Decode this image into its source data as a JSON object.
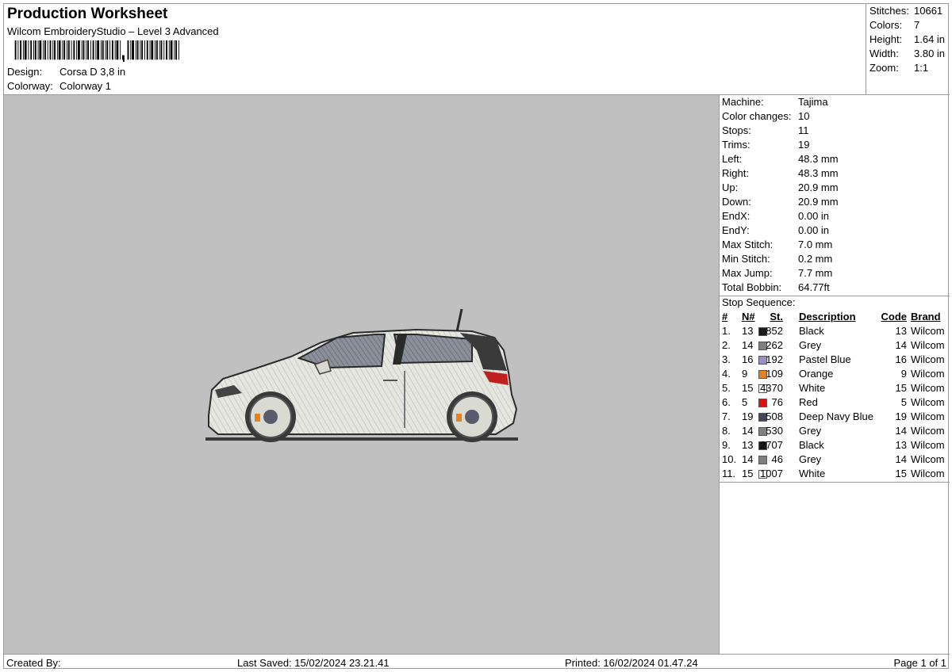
{
  "header": {
    "title": "Production Worksheet",
    "subtitle": "Wilcom EmbroideryStudio – Level 3 Advanced",
    "design_label": "Design:",
    "design_value": "Corsa D 3,8 in",
    "colorway_label": "Colorway:",
    "colorway_value": "Colorway 1"
  },
  "summary": [
    {
      "label": "Stitches:",
      "value": "10661"
    },
    {
      "label": "Colors:",
      "value": "7"
    },
    {
      "label": "Height:",
      "value": "1.64 in"
    },
    {
      "label": "Width:",
      "value": "3.80 in"
    },
    {
      "label": "Zoom:",
      "value": "1:1"
    }
  ],
  "machine_info": [
    {
      "label": "Machine:",
      "value": "Tajima"
    },
    {
      "label": "Color changes:",
      "value": "10"
    },
    {
      "label": "Stops:",
      "value": "11"
    },
    {
      "label": "Trims:",
      "value": "19"
    },
    {
      "label": "Left:",
      "value": "48.3 mm"
    },
    {
      "label": "Right:",
      "value": "48.3 mm"
    },
    {
      "label": "Up:",
      "value": "20.9 mm"
    },
    {
      "label": "Down:",
      "value": "20.9 mm"
    },
    {
      "label": "EndX:",
      "value": "0.00 in"
    },
    {
      "label": "EndY:",
      "value": "0.00 in"
    },
    {
      "label": "Max Stitch:",
      "value": "7.0 mm"
    },
    {
      "label": "Min Stitch:",
      "value": "0.2 mm"
    },
    {
      "label": "Max Jump:",
      "value": "7.7 mm"
    },
    {
      "label": "Total Bobbin:",
      "value": "64.77ft"
    }
  ],
  "stop_sequence": {
    "title": "Stop Sequence:",
    "headers": {
      "num": "#",
      "n": "N#",
      "st": "St.",
      "desc": "Description",
      "code": "Code",
      "brand": "Brand"
    },
    "rows": [
      {
        "num": "1.",
        "n": "13",
        "color": "#1a1a1a",
        "st": "852",
        "desc": "Black",
        "code": "13",
        "brand": "Wilcom"
      },
      {
        "num": "2.",
        "n": "14",
        "color": "#808080",
        "st": "262",
        "desc": "Grey",
        "code": "14",
        "brand": "Wilcom"
      },
      {
        "num": "3.",
        "n": "16",
        "color": "#9b8fc4",
        "st": "192",
        "desc": "Pastel Blue",
        "code": "16",
        "brand": "Wilcom"
      },
      {
        "num": "4.",
        "n": "9",
        "color": "#e8821e",
        "st": "109",
        "desc": "Orange",
        "code": "9",
        "brand": "Wilcom"
      },
      {
        "num": "5.",
        "n": "15",
        "color": "#ffffff",
        "st": "4370",
        "desc": "White",
        "code": "15",
        "brand": "Wilcom"
      },
      {
        "num": "6.",
        "n": "5",
        "color": "#e01010",
        "st": "76",
        "desc": "Red",
        "code": "5",
        "brand": "Wilcom"
      },
      {
        "num": "7.",
        "n": "19",
        "color": "#45445a",
        "st": "508",
        "desc": "Deep Navy Blue",
        "code": "19",
        "brand": "Wilcom"
      },
      {
        "num": "8.",
        "n": "14",
        "color": "#808080",
        "st": "530",
        "desc": "Grey",
        "code": "14",
        "brand": "Wilcom"
      },
      {
        "num": "9.",
        "n": "13",
        "color": "#1a1a1a",
        "st": "2707",
        "desc": "Black",
        "code": "13",
        "brand": "Wilcom"
      },
      {
        "num": "10.",
        "n": "14",
        "color": "#808080",
        "st": "46",
        "desc": "Grey",
        "code": "14",
        "brand": "Wilcom"
      },
      {
        "num": "11.",
        "n": "15",
        "color": "#ffffff",
        "st": "1007",
        "desc": "White",
        "code": "15",
        "brand": "Wilcom"
      }
    ]
  },
  "footer": {
    "created_by": "Created By:",
    "last_saved": "Last Saved: 15/02/2024 23.21.41",
    "printed": "Printed: 16/02/2024 01.47.24",
    "page": "Page 1 of 1"
  },
  "preview": {
    "background": "#c0c0c0",
    "icon": "embroidered-car-design"
  }
}
